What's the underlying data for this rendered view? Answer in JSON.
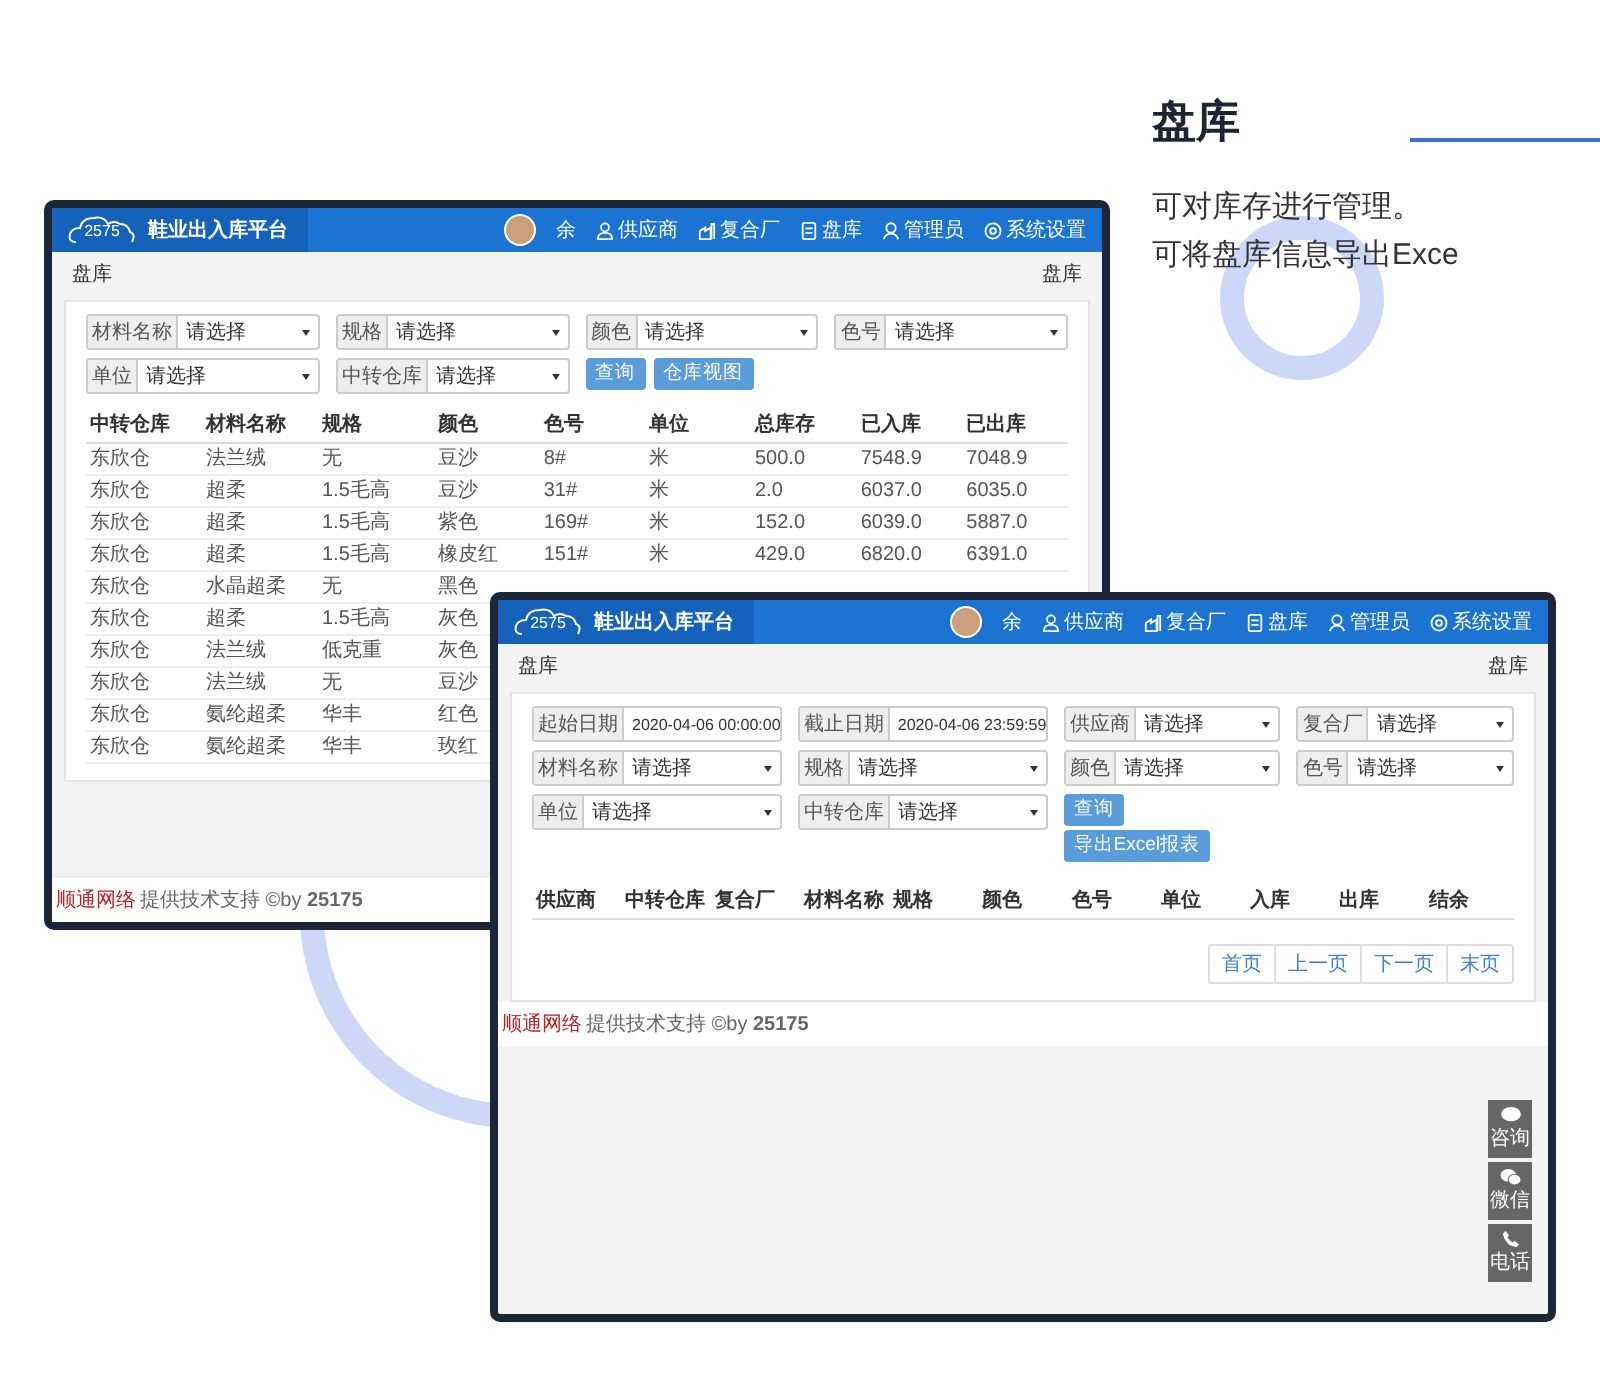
{
  "heading": {
    "title": "盘库",
    "lines": [
      "可对库存进行管理。",
      "可将盘库信息导出Exce"
    ]
  },
  "windows": [
    {
      "logo_text": "2575",
      "app_title": "鞋业出入库平台",
      "user": "余",
      "nav": [
        "供应商",
        "复合厂",
        "盘库",
        "管理员",
        "系统设置"
      ],
      "breadcrumb": "盘库",
      "breadcrumb_right": "盘库",
      "filters": [
        {
          "kind": "select",
          "label": "材料名称",
          "value": "请选择"
        },
        {
          "kind": "select",
          "label": "规格",
          "value": "请选择"
        },
        {
          "kind": "select",
          "label": "颜色",
          "value": "请选择"
        },
        {
          "kind": "select",
          "label": "色号",
          "value": "请选择"
        },
        {
          "kind": "select",
          "label": "单位",
          "value": "请选择"
        },
        {
          "kind": "select",
          "label": "中转仓库",
          "value": "请选择"
        }
      ],
      "buttons": [
        "查询",
        "仓库视图"
      ],
      "table": {
        "columns": [
          "中转仓库",
          "材料名称",
          "规格",
          "颜色",
          "色号",
          "单位",
          "总库存",
          "已入库",
          "已出库"
        ],
        "rows": [
          [
            "东欣仓",
            "法兰绒",
            "无",
            "豆沙",
            "8#",
            "米",
            "500.0",
            "7548.9",
            "7048.9"
          ],
          [
            "东欣仓",
            "超柔",
            "1.5毛高",
            "豆沙",
            "31#",
            "米",
            "2.0",
            "6037.0",
            "6035.0"
          ],
          [
            "东欣仓",
            "超柔",
            "1.5毛高",
            "紫色",
            "169#",
            "米",
            "152.0",
            "6039.0",
            "5887.0"
          ],
          [
            "东欣仓",
            "超柔",
            "1.5毛高",
            "橡皮红",
            "151#",
            "米",
            "429.0",
            "6820.0",
            "6391.0"
          ],
          [
            "东欣仓",
            "水晶超柔",
            "无",
            "黑色"
          ],
          [
            "东欣仓",
            "超柔",
            "1.5毛高",
            "灰色"
          ],
          [
            "东欣仓",
            "法兰绒",
            "低克重",
            "灰色"
          ],
          [
            "东欣仓",
            "法兰绒",
            "无",
            "豆沙"
          ],
          [
            "东欣仓",
            "氨纶超柔",
            "华丰",
            "红色"
          ],
          [
            "东欣仓",
            "氨纶超柔",
            "华丰",
            "玫红"
          ]
        ]
      },
      "footer": {
        "brand": "顺通网络",
        "text": "提供技术支持 ©by **25175**"
      }
    },
    {
      "logo_text": "2575",
      "app_title": "鞋业出入库平台",
      "user": "余",
      "nav": [
        "供应商",
        "复合厂",
        "盘库",
        "管理员",
        "系统设置"
      ],
      "breadcrumb": "盘库",
      "breadcrumb_right": "盘库",
      "filters": [
        {
          "kind": "input",
          "label": "起始日期",
          "value": "2020-04-06 00:00:00"
        },
        {
          "kind": "input",
          "label": "截止日期",
          "value": "2020-04-06 23:59:59"
        },
        {
          "kind": "select",
          "label": "供应商",
          "value": "请选择"
        },
        {
          "kind": "select",
          "label": "复合厂",
          "value": "请选择"
        },
        {
          "kind": "select",
          "label": "材料名称",
          "value": "请选择"
        },
        {
          "kind": "select",
          "label": "规格",
          "value": "请选择"
        },
        {
          "kind": "select",
          "label": "颜色",
          "value": "请选择"
        },
        {
          "kind": "select",
          "label": "色号",
          "value": "请选择"
        },
        {
          "kind": "select",
          "label": "单位",
          "value": "请选择"
        },
        {
          "kind": "select",
          "label": "中转仓库",
          "value": "请选择"
        }
      ],
      "buttons": [
        "查询",
        "导出Excel报表"
      ],
      "table": {
        "columns": [
          "供应商",
          "中转仓库",
          "复合厂",
          "材料名称",
          "规格",
          "颜色",
          "色号",
          "单位",
          "入库",
          "出库",
          "结余"
        ]
      },
      "pagination": [
        "首页",
        "上一页",
        "下一页",
        "末页"
      ],
      "footer": {
        "brand": "顺通网络",
        "text": "提供技术支持 ©by **25175**"
      },
      "side_buttons": [
        "咨询",
        "微信",
        "电话"
      ]
    }
  ]
}
